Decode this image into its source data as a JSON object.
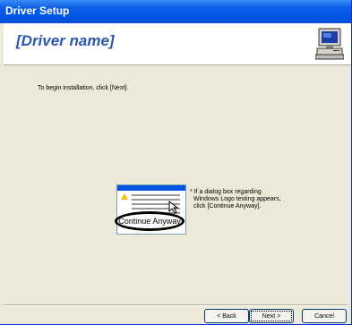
{
  "window": {
    "title": "Driver Setup"
  },
  "header": {
    "driver_name": "[Driver name]",
    "icon": "computer-setup-icon"
  },
  "body": {
    "intro": "To begin installation, click [Next].",
    "thumbnail_button": "Continue Anyway",
    "note_lines": [
      "* If a dialog box regarding",
      "  Windows Logo testing appears,",
      "  click [Continue Anyway]."
    ]
  },
  "footer": {
    "back_label": "< Back",
    "next_label": "Next >",
    "cancel_label": "Cancel"
  }
}
